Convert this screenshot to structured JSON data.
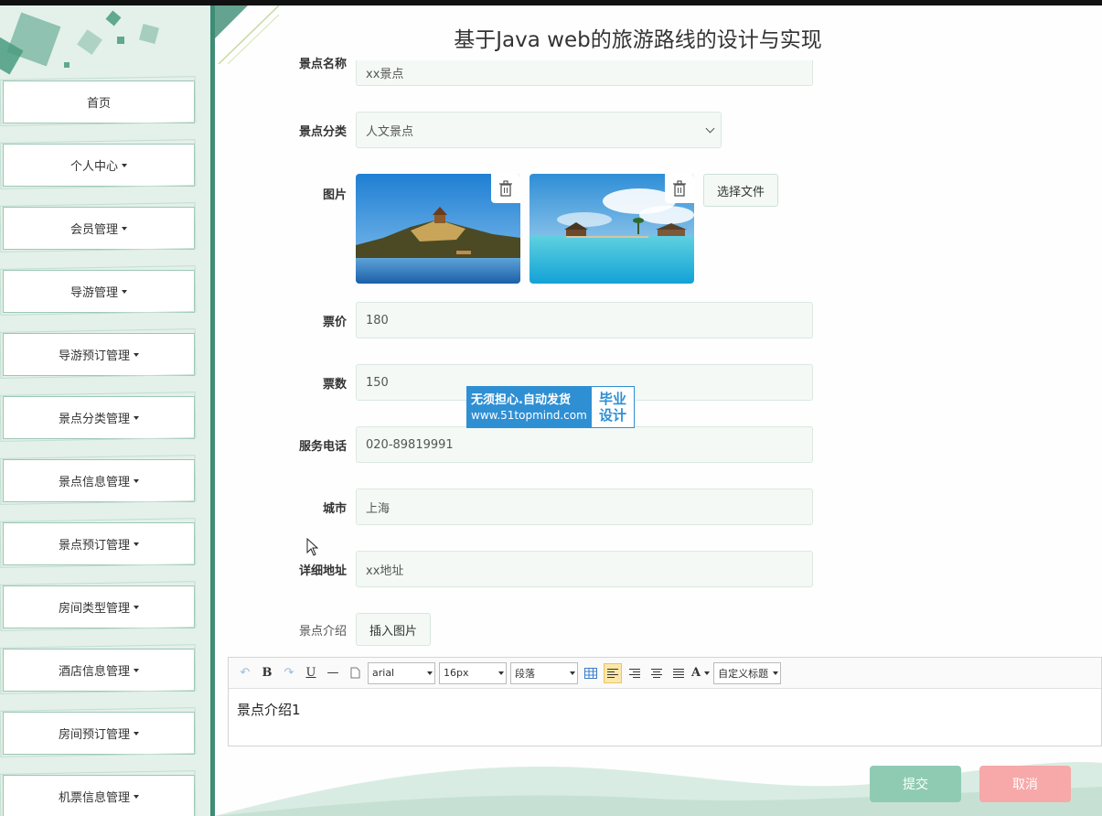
{
  "app": {
    "title": "基于Java web的旅游路线的设计与实现"
  },
  "sidebar": {
    "items": [
      {
        "label": "首页"
      },
      {
        "label": "个人中心"
      },
      {
        "label": "会员管理"
      },
      {
        "label": "导游管理"
      },
      {
        "label": "导游预订管理"
      },
      {
        "label": "景点分类管理"
      },
      {
        "label": "景点信息管理"
      },
      {
        "label": "景点预订管理"
      },
      {
        "label": "房间类型管理"
      },
      {
        "label": "酒店信息管理"
      },
      {
        "label": "房间预订管理"
      },
      {
        "label": "机票信息管理"
      }
    ]
  },
  "form": {
    "name": {
      "label": "景点名称",
      "value": "xx景点"
    },
    "category": {
      "label": "景点分类",
      "value": "人文景点"
    },
    "image": {
      "label": "图片",
      "choose_file": "选择文件"
    },
    "price": {
      "label": "票价",
      "value": "180"
    },
    "tickets": {
      "label": "票数",
      "value": "150"
    },
    "phone": {
      "label": "服务电话",
      "value": "020-89819991"
    },
    "city": {
      "label": "城市",
      "value": "上海"
    },
    "address": {
      "label": "详细地址",
      "value": "xx地址"
    },
    "intro": {
      "label": "景点介绍",
      "insert_image": "插入图片"
    }
  },
  "editor": {
    "font_family": "arial",
    "font_size": "16px",
    "paragraph": "段落",
    "custom_title": "自定义标题",
    "content": "景点介绍1"
  },
  "actions": {
    "submit": "提交",
    "cancel": "取消"
  },
  "watermark": {
    "line1": "无须担心.自动发货",
    "line2": "www.51topmind.com",
    "right1": "毕业",
    "right2": "设计"
  },
  "colors": {
    "accent": "#3e8c75",
    "sidebar_bg": "#e3f1ea",
    "submit": "#8fcbb3",
    "cancel": "#f7a8a8"
  }
}
